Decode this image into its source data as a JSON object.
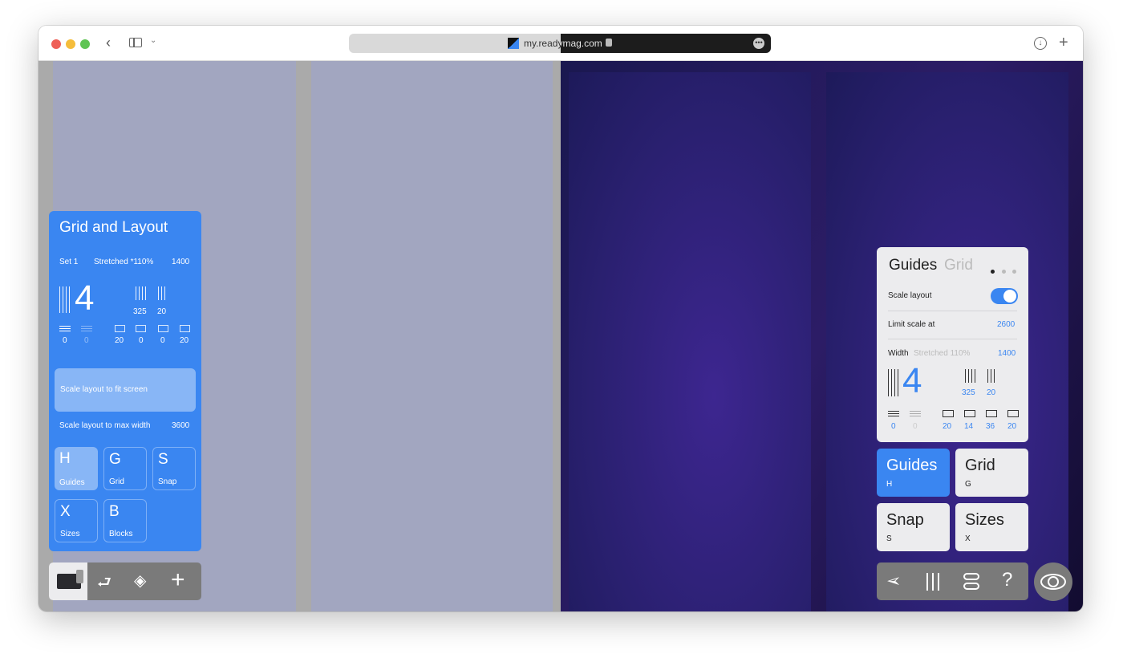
{
  "browser": {
    "url": "my.readymag.com"
  },
  "left_panel": {
    "title": "Grid and Layout",
    "set": "Set 1",
    "mode": "Stretched *110%",
    "width": "1400",
    "columns": "4",
    "column_width": "325",
    "gutter": "20",
    "margins": [
      "0",
      "0",
      "20",
      "0",
      "0",
      "20"
    ],
    "fit_label": "Scale layout to fit screen",
    "max_label": "Scale layout to max width",
    "max_value": "3600",
    "tiles": [
      {
        "key": "H",
        "label": "Guides",
        "active": true
      },
      {
        "key": "G",
        "label": "Grid"
      },
      {
        "key": "S",
        "label": "Snap"
      },
      {
        "key": "X",
        "label": "Sizes"
      },
      {
        "key": "B",
        "label": "Blocks"
      }
    ]
  },
  "right_card": {
    "tab_active": "Guides",
    "tab_inactive": "Grid",
    "scale_label": "Scale layout",
    "scale_on": true,
    "limit_label": "Limit scale at",
    "limit_value": "2600",
    "width_label": "Width",
    "width_mode": "Stretched 110%",
    "width_value": "1400",
    "columns": "4",
    "column_width": "325",
    "gutter": "20",
    "margins": [
      "0",
      "0",
      "20",
      "14",
      "36",
      "20"
    ]
  },
  "right_buttons": [
    {
      "label": "Guides",
      "key": "H",
      "active": true
    },
    {
      "label": "Grid",
      "key": "G"
    },
    {
      "label": "Snap",
      "key": "S"
    },
    {
      "label": "Sizes",
      "key": "X"
    }
  ],
  "colors": {
    "accent": "#3a86f1",
    "panel_bg": "#ececee",
    "toolbar": "#7a7a7a"
  }
}
